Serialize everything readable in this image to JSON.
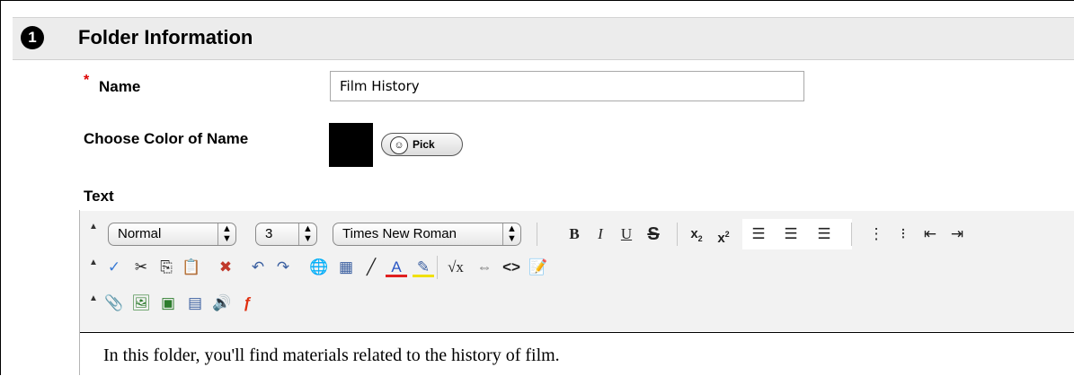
{
  "section": {
    "step": "1",
    "title": "Folder Information"
  },
  "name_field": {
    "required_mark": "*",
    "label": "Name",
    "value": "Film History"
  },
  "color_field": {
    "label": "Choose Color of Name",
    "pick_label": "Pick",
    "color": "#000000"
  },
  "text_field": {
    "label": "Text"
  },
  "toolbar": {
    "format_select": "Normal",
    "size_select": "3",
    "font_select": "Times New Roman",
    "bold": "B",
    "italic": "I",
    "underline": "U",
    "strike": "S"
  },
  "editor": {
    "content": "In this folder, you'll find materials related to the history of film."
  }
}
